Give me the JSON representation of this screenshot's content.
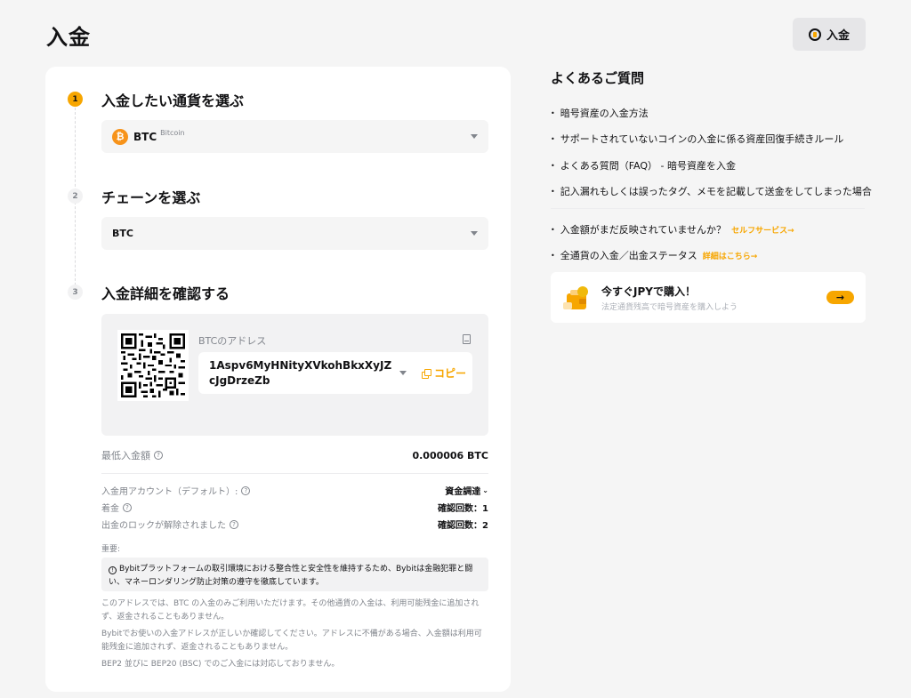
{
  "page": {
    "title": "入金"
  },
  "header": {
    "deposit_button": "入金"
  },
  "steps": [
    {
      "number": "1",
      "title": "入金したい通貨を選ぶ"
    },
    {
      "number": "2",
      "title": "チェーンを選ぶ"
    },
    {
      "number": "3",
      "title": "入金詳細を確認する"
    }
  ],
  "coin_select": {
    "symbol": "BTC",
    "name": "Bitcoin",
    "icon_glyph": "₿"
  },
  "chain_select": {
    "value": "BTC"
  },
  "address": {
    "label": "BTCのアドレス",
    "value": "1Aspv6MyHNityXVkohBkxXyJZcJgDrzeZb",
    "copy_label": "コピー"
  },
  "details": {
    "min_deposit_label": "最低入金額",
    "min_deposit_value": "0.000006 BTC",
    "account_label": "入金用アカウント（デフォルト）:",
    "account_value": "資金調達",
    "credit_label": "着金",
    "credit_value": "確認回数：1",
    "unlock_label": "出金のロックが解除されました",
    "unlock_value": "確認回数：2"
  },
  "important": {
    "label": "重要:",
    "notice": "Bybitプラットフォームの取引環境における整合性と安全性を維持するため、Bybitは金融犯罪と闘い、マネーロンダリング防止対策の遵守を徹底しています。",
    "note1": "このアドレスでは、BTC の入金のみご利用いただけます。その他通貨の入金は、利用可能残金に追加されず、返金されることもありません。",
    "note2": "Bybitでお使いの入金アドレスが正しいか確認してください。アドレスに不備がある場合、入金額は利用可能残金に追加されず、返金されることもありません。",
    "note3": "BEP2 並びに BEP20 (BSC) でのご入金には対応しておりません。"
  },
  "faq": {
    "title": "よくあるご質問",
    "items": [
      "暗号資産の入金方法",
      "サポートされていないコインの入金に係る資産回復手続きルール",
      "よくある質問（FAQ） - 暗号資産を入金",
      "記入漏れもしくは誤ったタグ、メモを記載して送金をしてしまった場合"
    ],
    "pending_text": "入金額がまだ反映されていませんか？",
    "pending_link": "セルフサービス→",
    "status_text": "全通貨の入金／出金ステータス",
    "status_link": "詳細はこちら→"
  },
  "promo": {
    "title": "今すぐJPYで購入！",
    "subtitle": "法定通貨残高で暗号資産を購入しよう",
    "arrow": "→"
  },
  "colors": {
    "accent": "#f7a600",
    "btc": "#f7931a",
    "muted": "#81858c",
    "background": "#f5f5f5"
  }
}
